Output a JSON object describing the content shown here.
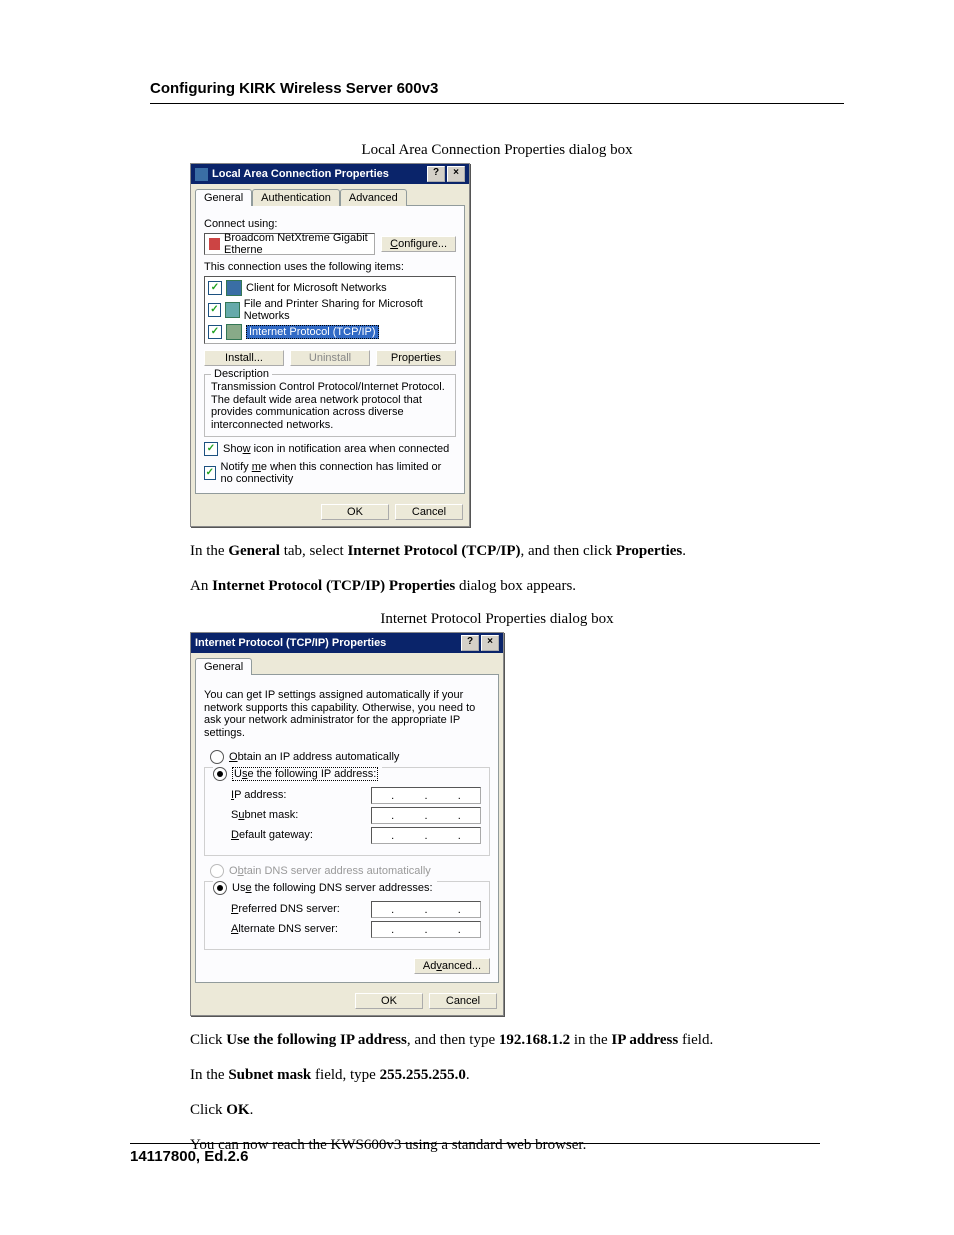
{
  "doc": {
    "section_title": "Configuring KIRK Wireless Server 600v3",
    "caption1": "Local Area Connection Properties dialog box",
    "caption2": "Internet Protocol Properties dialog box",
    "para1_pre": "In the ",
    "para1_b1": "General",
    "para1_mid1": " tab, select ",
    "para1_b2": "Internet Protocol (TCP/IP)",
    "para1_mid2": ", and then click ",
    "para1_b3": "Properties",
    "para1_end": ".",
    "para2_pre": "An ",
    "para2_b1": "Internet Protocol (TCP/IP) Properties",
    "para2_end": " dialog box appears.",
    "para3_pre": "Click ",
    "para3_b1": "Use the following IP address",
    "para3_mid1": ", and then type ",
    "para3_b2": "192.168.1.2",
    "para3_mid2": " in the ",
    "para3_b3": "IP address",
    "para3_end": " field.",
    "para4_pre": "In the ",
    "para4_b1": "Subnet mask",
    "para4_mid1": " field, type ",
    "para4_b2": "255.255.255.0",
    "para4_end": ".",
    "para5_pre": "Click ",
    "para5_b1": "OK",
    "para5_end": ".",
    "para6": "You can now reach the KWS600v3 using a standard web browser.",
    "doc_id": "14117800, Ed.2.6"
  },
  "dlg1": {
    "title": "Local Area Connection Properties",
    "help": "?",
    "close": "×",
    "tabs": {
      "general": "General",
      "auth": "Authentication",
      "adv": "Advanced"
    },
    "connect_using": "Connect using:",
    "adapter": "Broadcom NetXtreme Gigabit Etherne",
    "configure": "Configure...",
    "uses_items": "This connection uses the following items:",
    "items": [
      "Client for Microsoft Networks",
      "File and Printer Sharing for Microsoft Networks",
      "Internet Protocol (TCP/IP)"
    ],
    "install": "Install...",
    "uninstall": "Uninstall",
    "properties": "Properties",
    "description_label": "Description",
    "description": "Transmission Control Protocol/Internet Protocol. The default wide area network protocol that provides communication across diverse interconnected networks.",
    "show_icon": "Show icon in notification area when connected",
    "notify": "Notify me when this connection has limited or no connectivity",
    "ok": "OK",
    "cancel": "Cancel"
  },
  "dlg2": {
    "title": "Internet Protocol (TCP/IP) Properties",
    "help": "?",
    "close": "×",
    "tab_general": "General",
    "intro": "You can get IP settings assigned automatically if your network supports this capability. Otherwise, you need to ask your network administrator for the appropriate IP settings.",
    "r_obtain_ip": "Obtain an IP address automatically",
    "r_use_ip": "Use the following IP address:",
    "ip_address": "IP address:",
    "subnet": "Subnet mask:",
    "gateway": "Default gateway:",
    "r_obtain_dns": "Obtain DNS server address automatically",
    "r_use_dns": "Use the following DNS server addresses:",
    "pref_dns": "Preferred DNS server:",
    "alt_dns": "Alternate DNS server:",
    "advanced": "Advanced...",
    "ok": "OK",
    "cancel": "Cancel"
  }
}
